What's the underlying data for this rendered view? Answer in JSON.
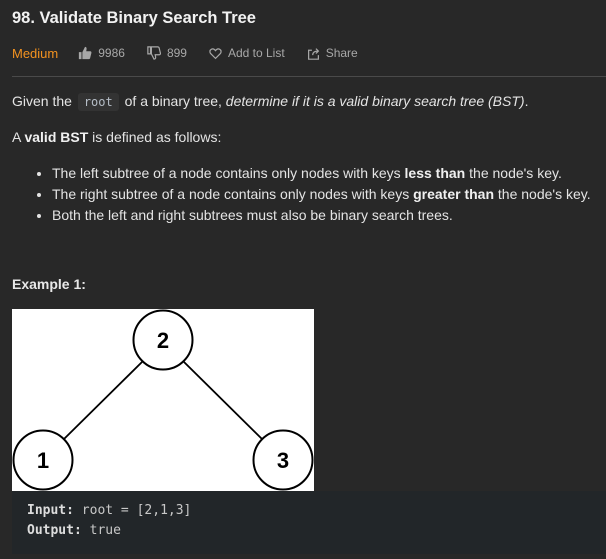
{
  "problem": {
    "title": "98. Validate Binary Search Tree",
    "difficulty": "Medium",
    "likes": "9986",
    "dislikes": "899",
    "add_to_list": "Add to List",
    "share": "Share"
  },
  "description": {
    "intro_prefix": "Given the",
    "intro_code": "root",
    "intro_mid": "of a binary tree,",
    "intro_emphasis": "determine if it is a valid binary search tree (BST)",
    "intro_suffix": ".",
    "def_prefix": "A",
    "def_bold": "valid BST",
    "def_suffix": "is defined as follows:",
    "rules": [
      {
        "pre": "The left subtree of a node contains only nodes with keys",
        "bold": "less than",
        "post": "the node's key."
      },
      {
        "pre": "The right subtree of a node contains only nodes with keys",
        "bold": "greater than",
        "post": "the node's key."
      },
      {
        "pre": "Both the left and right subtrees must also be binary search trees.",
        "bold": "",
        "post": ""
      }
    ]
  },
  "example": {
    "heading": "Example 1:",
    "tree_nodes": [
      "2",
      "1",
      "3"
    ],
    "input_label": "Input:",
    "input_value": "root = [2,1,3]",
    "output_label": "Output:",
    "output_value": "true"
  },
  "colors": {
    "background": "#282828",
    "difficulty_medium": "#f29220",
    "code_block_bg": "#222629"
  }
}
